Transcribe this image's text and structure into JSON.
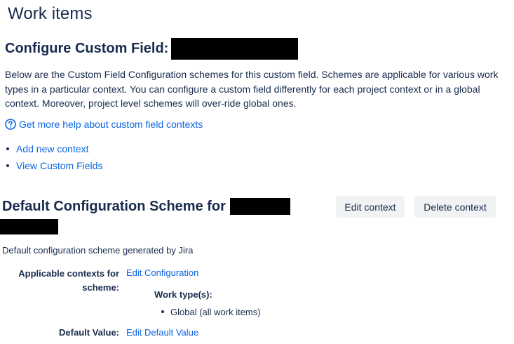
{
  "page": {
    "title": "Work items"
  },
  "custom_field": {
    "title": "Configure Custom Field:",
    "description": "Below are the Custom Field Configuration schemes for this custom field. Schemes are applicable for various work types in a particular context. You can configure a custom field differently for each project context or in a global context. Moreover, project level schemes will over-ride global ones.",
    "help_link": "Get more help about custom field contexts",
    "actions": [
      {
        "label": "Add new context"
      },
      {
        "label": "View Custom Fields"
      }
    ]
  },
  "scheme": {
    "title": "Default Configuration Scheme for",
    "edit_context_label": "Edit context",
    "delete_context_label": "Delete context",
    "description": "Default configuration scheme generated by Jira",
    "applicable_label": "Applicable contexts for scheme:",
    "edit_configuration_link": "Edit Configuration",
    "work_types_heading": "Work type(s):",
    "work_types": [
      "Global (all work items)"
    ],
    "default_value_label": "Default Value:",
    "edit_default_value_link": "Edit Default Value"
  },
  "colors": {
    "text": "#172b4d",
    "link": "#0c66e4",
    "button_bg": "#f1f2f4",
    "redaction": "#000000"
  },
  "icons": {
    "help": "question-circle-icon"
  }
}
